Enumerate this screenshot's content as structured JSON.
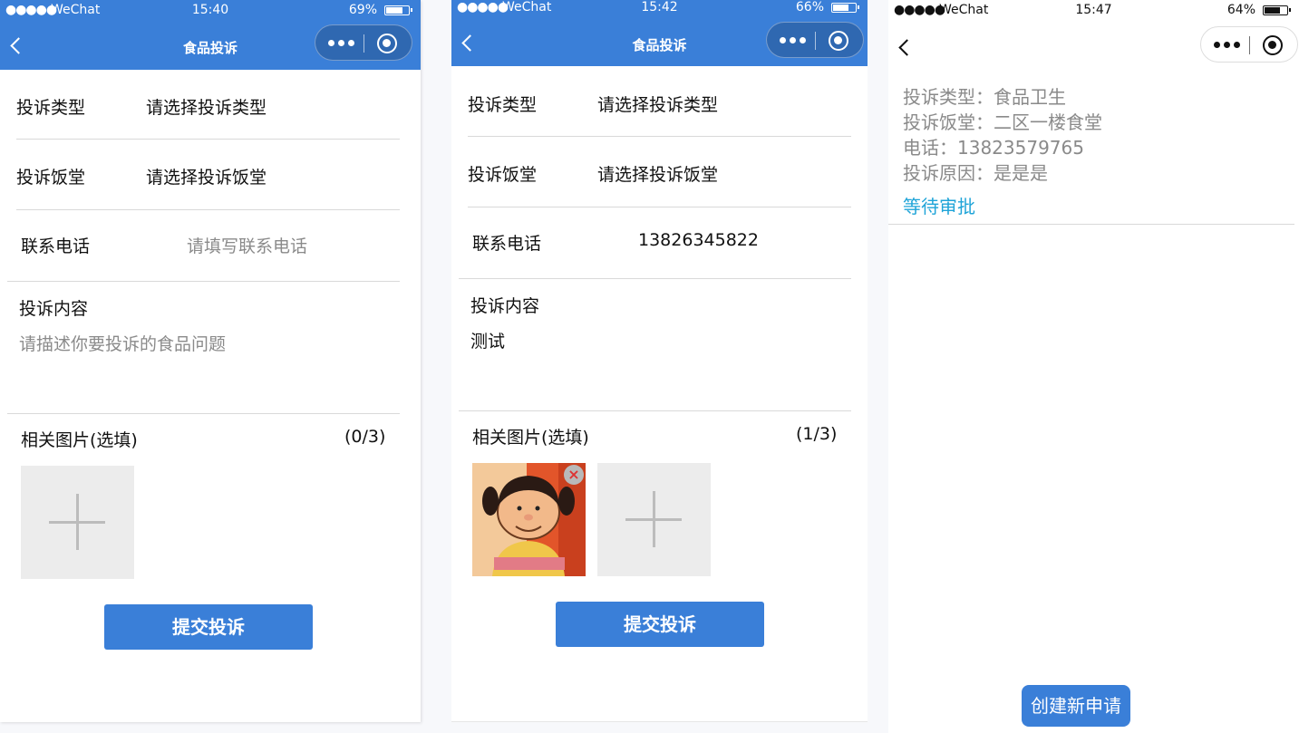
{
  "colors": {
    "brand_blue": "#3a7fd8",
    "status_cyan": "#1fa4d8",
    "placeholder_gray": "#8a8a8a"
  },
  "screen1": {
    "status": {
      "signal": "●●●●●",
      "carrier": "WeChat",
      "time": "15:40",
      "battery": "69%"
    },
    "nav": {
      "title": "食品投诉"
    },
    "type_label": "投诉类型",
    "type_value": "请选择投诉类型",
    "canteen_label": "投诉饭堂",
    "canteen_value": "请选择投诉饭堂",
    "phone_label": "联系电话",
    "phone_placeholder": "请填写联系电话",
    "content_label": "投诉内容",
    "content_placeholder": "请描述你要投诉的食品问题",
    "images_label": "相关图片(选填)",
    "images_count": "(0/3)",
    "submit_label": "提交投诉"
  },
  "screen2": {
    "status": {
      "signal": "●●●●●",
      "carrier": "WeChat",
      "time": "15:42",
      "battery": "66%"
    },
    "nav": {
      "title": "食品投诉"
    },
    "type_label": "投诉类型",
    "type_value": "请选择投诉类型",
    "canteen_label": "投诉饭堂",
    "canteen_value": "请选择投诉饭堂",
    "phone_label": "联系电话",
    "phone_value": "13826345822",
    "content_label": "投诉内容",
    "content_value": "测试",
    "images_label": "相关图片(选填)",
    "images_count": "(1/3)",
    "delete_glyph": "×",
    "submit_label": "提交投诉"
  },
  "screen3": {
    "status": {
      "signal": "●●●●●",
      "carrier": "WeChat",
      "time": "15:47",
      "battery": "64%"
    },
    "record": {
      "type": "投诉类型：食品卫生",
      "canteen": "投诉饭堂：二区一楼食堂",
      "phone": "电话：13823579765",
      "reason": "投诉原因：是是是",
      "status": "等待审批"
    },
    "new_button": "创建新申请"
  }
}
